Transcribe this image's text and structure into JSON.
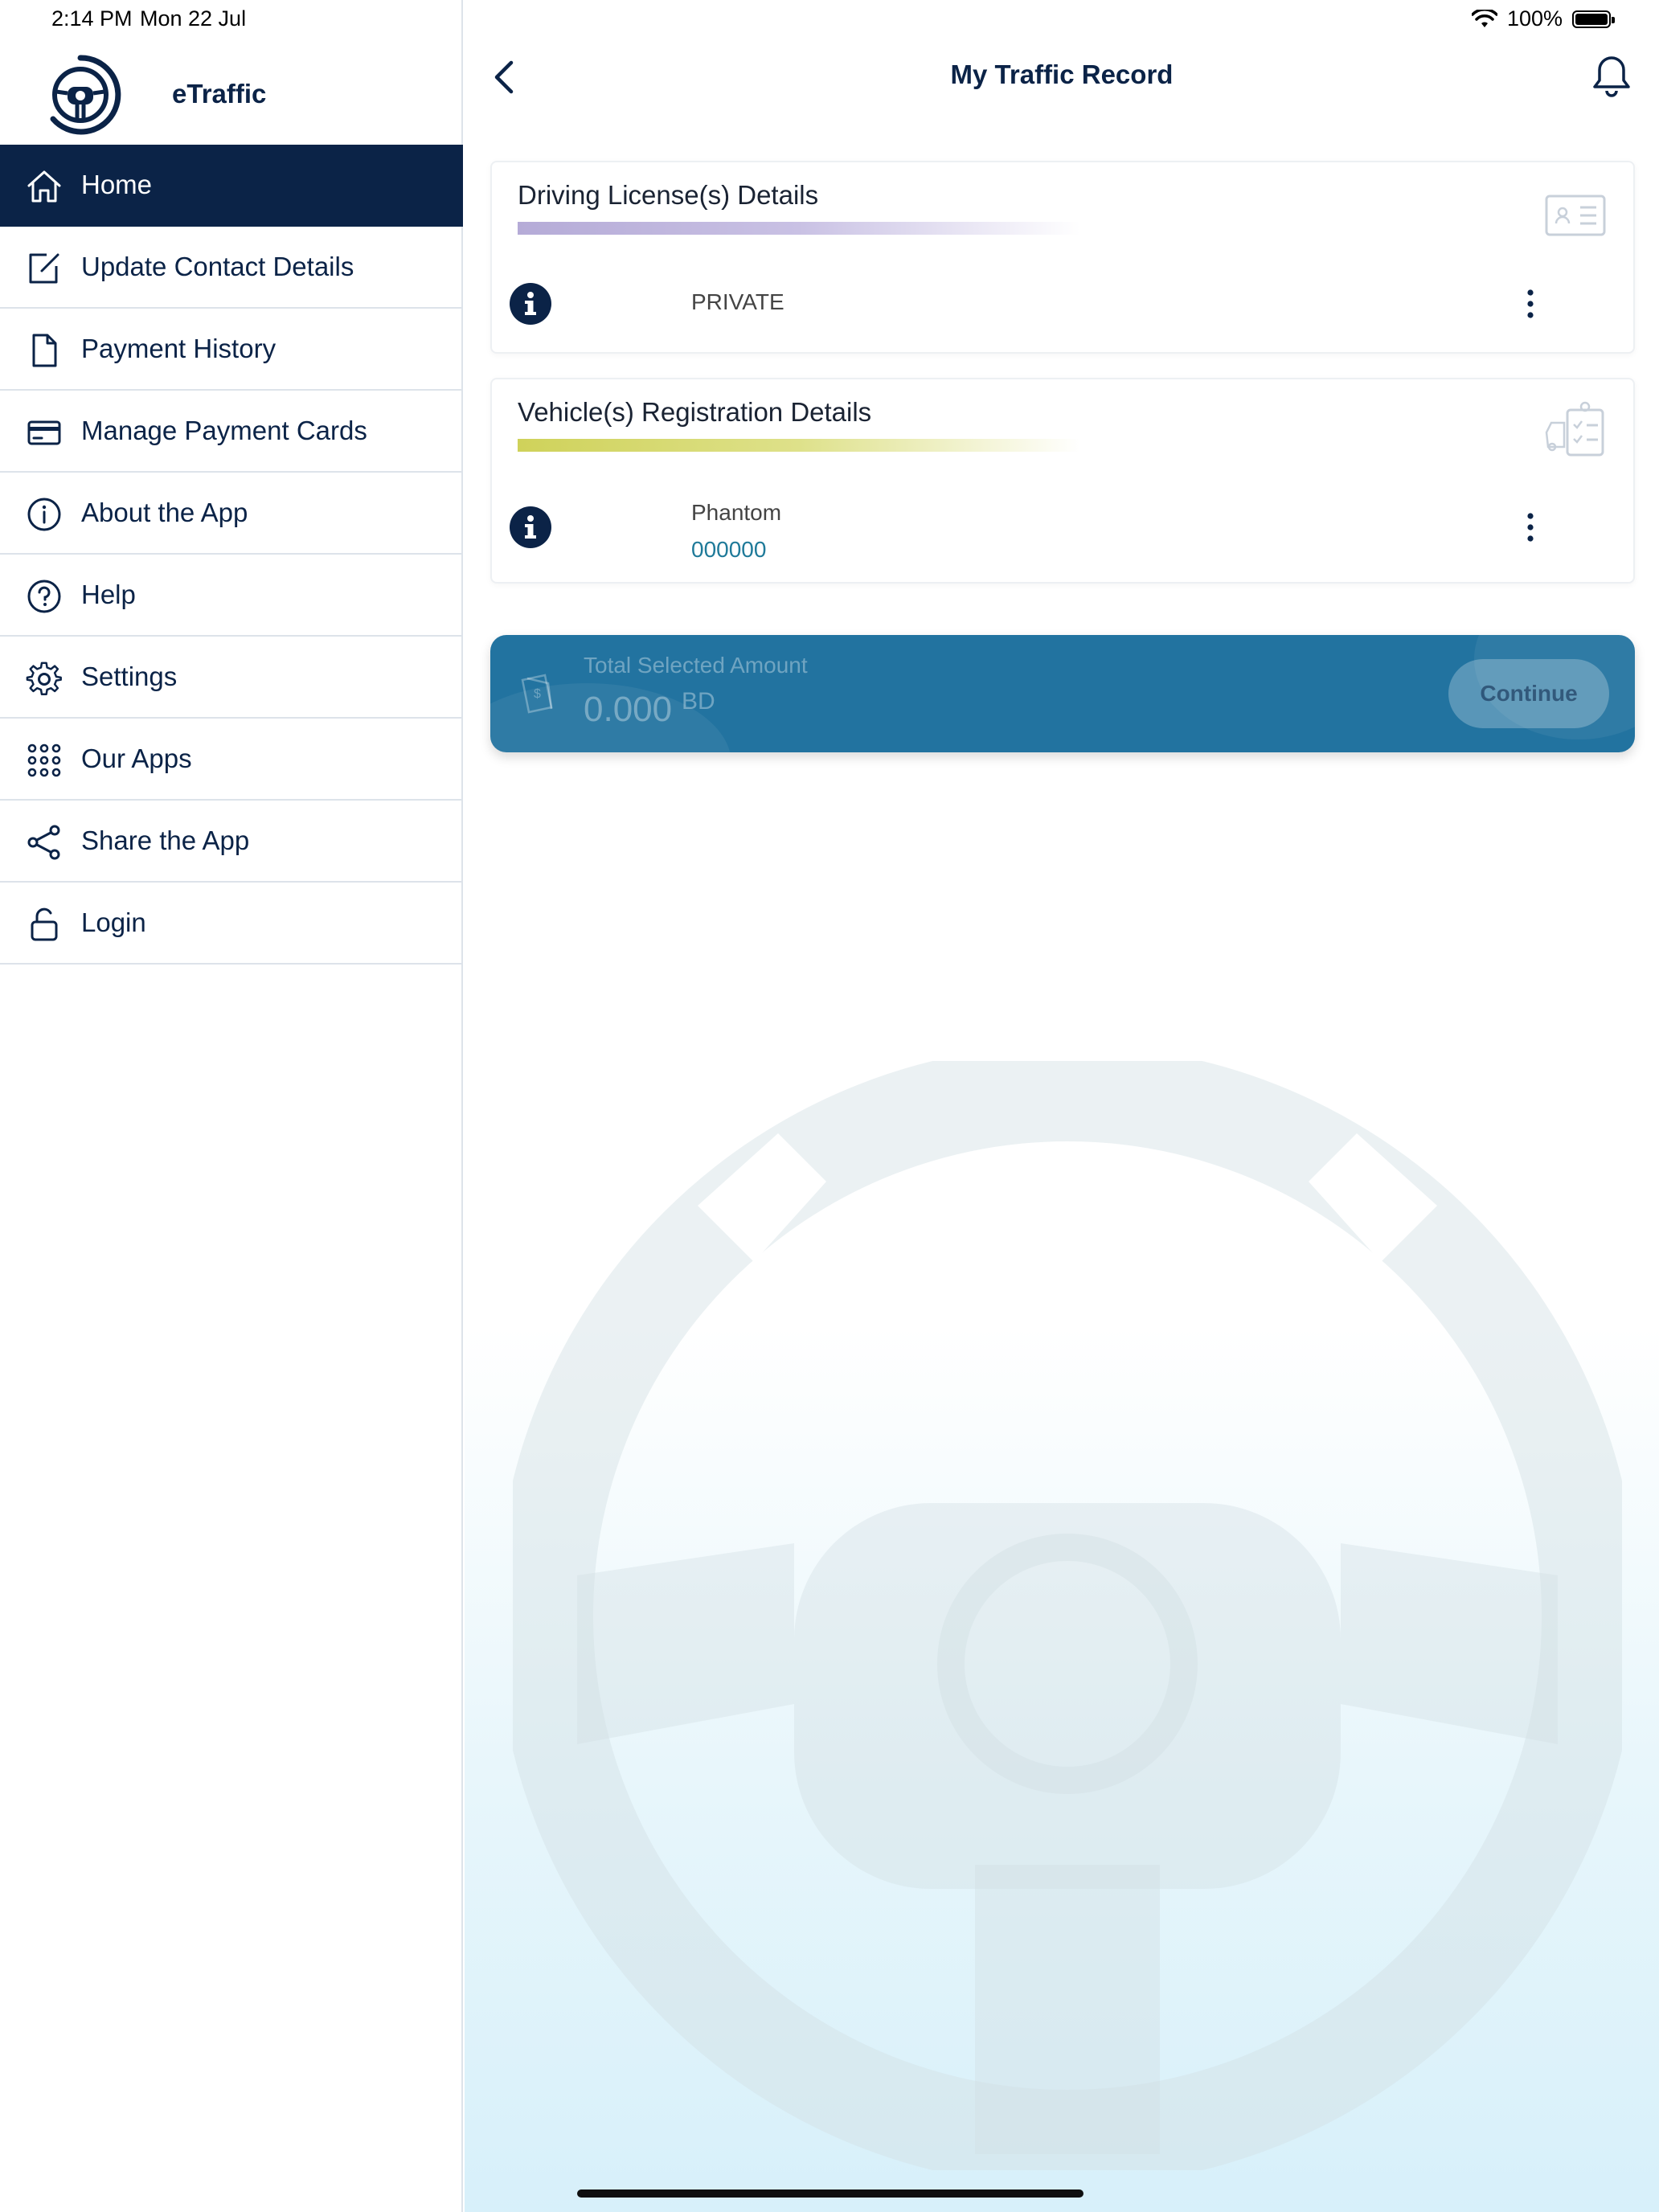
{
  "status_bar": {
    "time": "2:14 PM",
    "date": "Mon 22 Jul",
    "battery": "100%"
  },
  "sidebar": {
    "brand": "eTraffic",
    "items": [
      {
        "label": "Home",
        "icon": "home-icon",
        "active": true
      },
      {
        "label": "Update Contact Details",
        "icon": "edit-icon"
      },
      {
        "label": "Payment History",
        "icon": "document-icon"
      },
      {
        "label": "Manage Payment Cards",
        "icon": "credit-card-icon"
      },
      {
        "label": "About the App",
        "icon": "info-icon"
      },
      {
        "label": "Help",
        "icon": "question-icon"
      },
      {
        "label": "Settings",
        "icon": "gear-icon"
      },
      {
        "label": "Our Apps",
        "icon": "grid-icon"
      },
      {
        "label": "Share the App",
        "icon": "share-icon"
      },
      {
        "label": "Login",
        "icon": "unlock-icon"
      }
    ]
  },
  "header": {
    "title": "My Traffic Record"
  },
  "license_card": {
    "title": "Driving License(s) Details",
    "type": "PRIVATE"
  },
  "vehicle_card": {
    "title": "Vehicle(s) Registration Details",
    "model": "Phantom",
    "plate": "000000"
  },
  "payment": {
    "label": "Total Selected Amount",
    "amount": "0.000",
    "currency": "BD",
    "continue_label": "Continue"
  },
  "colors": {
    "primary": "#0b2347",
    "accent": "#2273a0",
    "license_bar": "#b5abd7",
    "vehicle_bar": "#cfd25a",
    "link": "#1f7a99"
  }
}
